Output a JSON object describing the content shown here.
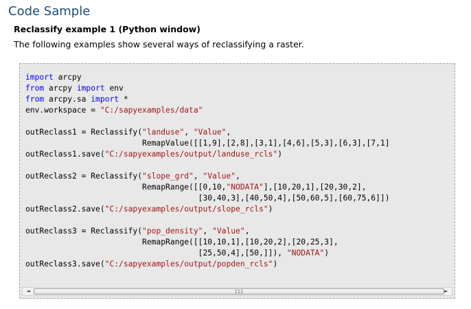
{
  "section_title": "Code Sample",
  "example_title": "Reclassify example 1 (Python window)",
  "intro_text": "The following examples show several ways of reclassifying a raster.",
  "code_lines": [
    [
      {
        "t": "kw",
        "v": "import"
      },
      {
        "t": "p",
        "v": " arcpy"
      }
    ],
    [
      {
        "t": "kw",
        "v": "from"
      },
      {
        "t": "p",
        "v": " arcpy "
      },
      {
        "t": "kw",
        "v": "import"
      },
      {
        "t": "p",
        "v": " env"
      }
    ],
    [
      {
        "t": "kw",
        "v": "from"
      },
      {
        "t": "p",
        "v": " arcpy.sa "
      },
      {
        "t": "kw",
        "v": "import"
      },
      {
        "t": "p",
        "v": " *"
      }
    ],
    [
      {
        "t": "p",
        "v": "env.workspace = "
      },
      {
        "t": "str",
        "v": "\"C:/sapyexamples/data\""
      }
    ],
    [],
    [
      {
        "t": "p",
        "v": "outReclass1 = Reclassify("
      },
      {
        "t": "str",
        "v": "\"landuse\""
      },
      {
        "t": "p",
        "v": ", "
      },
      {
        "t": "str",
        "v": "\"Value\""
      },
      {
        "t": "p",
        "v": ","
      }
    ],
    [
      {
        "t": "p",
        "v": "                         RemapValue([[1,9],[2,8],[3,1],[4,6],[5,3],[6,3],[7,1]"
      }
    ],
    [
      {
        "t": "p",
        "v": "outReclass1.save("
      },
      {
        "t": "str",
        "v": "\"C:/sapyexamples/output/landuse_rcls\""
      },
      {
        "t": "p",
        "v": ")"
      }
    ],
    [],
    [
      {
        "t": "p",
        "v": "outReclass2 = Reclassify("
      },
      {
        "t": "str",
        "v": "\"slope_grd\""
      },
      {
        "t": "p",
        "v": ", "
      },
      {
        "t": "str",
        "v": "\"Value\""
      },
      {
        "t": "p",
        "v": ","
      }
    ],
    [
      {
        "t": "p",
        "v": "                         RemapRange([[0,10,"
      },
      {
        "t": "str",
        "v": "\"NODATA\""
      },
      {
        "t": "p",
        "v": "],[10,20,1],[20,30,2],"
      }
    ],
    [
      {
        "t": "p",
        "v": "                                     [30,40,3],[40,50,4],[50,60,5],[60,75,6]])"
      }
    ],
    [
      {
        "t": "p",
        "v": "outReclass2.save("
      },
      {
        "t": "str",
        "v": "\"C:/sapyexamples/output/slope_rcls\""
      },
      {
        "t": "p",
        "v": ")"
      }
    ],
    [],
    [
      {
        "t": "p",
        "v": "outReclass3 = Reclassify("
      },
      {
        "t": "str",
        "v": "\"pop_density\""
      },
      {
        "t": "p",
        "v": ", "
      },
      {
        "t": "str",
        "v": "\"Value\""
      },
      {
        "t": "p",
        "v": ","
      }
    ],
    [
      {
        "t": "p",
        "v": "                         RemapRange([[10,10,1],[10,20,2],[20,25,3],"
      }
    ],
    [
      {
        "t": "p",
        "v": "                                     [25,50,4],[50,]]), "
      },
      {
        "t": "str",
        "v": "\"NODATA\""
      },
      {
        "t": "p",
        "v": ")"
      }
    ],
    [
      {
        "t": "p",
        "v": "outReclass3.save("
      },
      {
        "t": "str",
        "v": "\"C:/sapyexamples/output/popden_rcls\""
      },
      {
        "t": "p",
        "v": ")"
      }
    ]
  ],
  "scrollbar": {
    "left_arrow": "◄",
    "right_arrow": "►",
    "grip": "III",
    "position_fraction": 0.0
  },
  "colors": {
    "title": "#1c4e7a",
    "keyword": "#0000ff",
    "string": "#a31515",
    "code_background": "#e8e8e8"
  }
}
